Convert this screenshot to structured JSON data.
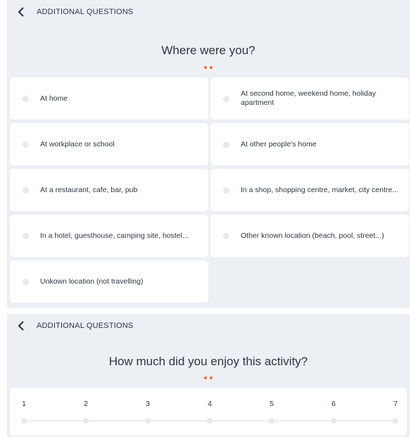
{
  "screen1": {
    "header": {
      "title": "ADDITIONAL QUESTIONS"
    },
    "question": "Where were you?",
    "options": [
      "At home",
      "At second home, weekend home, holiday apartment",
      "At workplace or school",
      "At other people's home",
      "At a restaurant, cafe, bar, pub",
      "In a shop, shopping centre, market, city centre...",
      "In a hotel, guesthouse, camping site, hostel...",
      "Other known location (beach, pool, street...)",
      "Unkown location (not travelling)"
    ]
  },
  "screen2": {
    "header": {
      "title": "ADDITIONAL QUESTIONS"
    },
    "question": "How much did you enjoy this activity?",
    "scale": [
      "1",
      "2",
      "3",
      "4",
      "5",
      "6",
      "7"
    ]
  },
  "colors": {
    "accent": "#ef6b3a",
    "background": "#eceff4",
    "card": "#ffffff"
  },
  "icons": {
    "back": "chevron-left-icon",
    "radio": "radio-circle"
  }
}
